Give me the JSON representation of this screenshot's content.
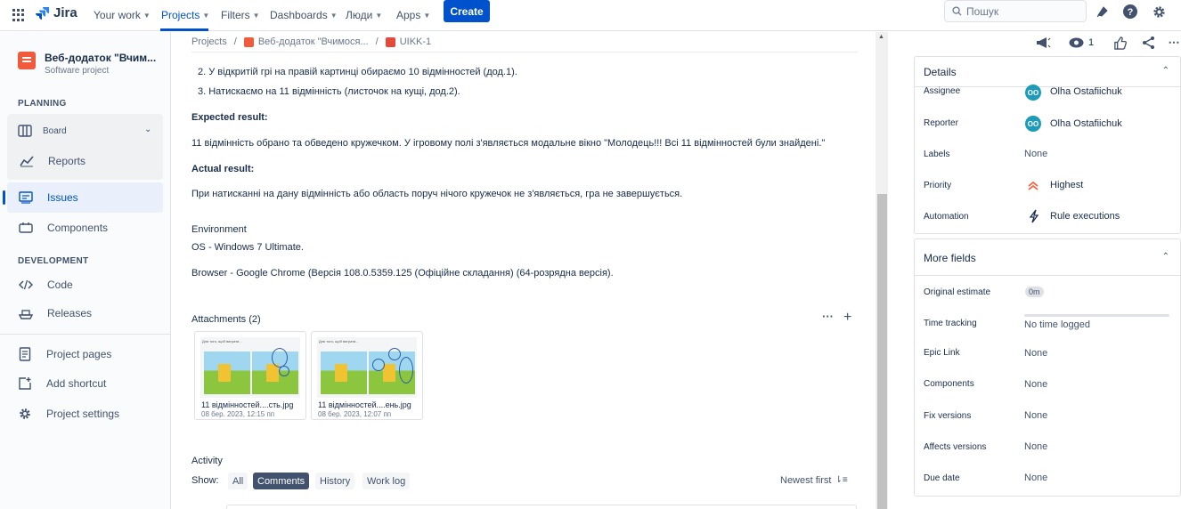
{
  "topnav": {
    "logo": "Jira",
    "items": [
      {
        "label": "Your work"
      },
      {
        "label": "Projects"
      },
      {
        "label": "Filters"
      },
      {
        "label": "Dashboards"
      },
      {
        "label": "Люди"
      },
      {
        "label": "Apps"
      }
    ],
    "create_label": "Create",
    "search_placeholder": "Пошук"
  },
  "sidebar": {
    "project_name": "Веб-додаток \"Вчим...",
    "project_type": "Software project",
    "planning_title": "PLANNING",
    "development_title": "DEVELOPMENT",
    "items": [
      {
        "label": "Board"
      },
      {
        "label": "Reports"
      },
      {
        "label": "Issues"
      },
      {
        "label": "Components"
      },
      {
        "label": "Code"
      },
      {
        "label": "Releases"
      },
      {
        "label": "Project pages"
      },
      {
        "label": "Add shortcut"
      },
      {
        "label": "Project settings"
      }
    ]
  },
  "breadcrumb": {
    "projects": "Projects",
    "project": "Веб-додаток \"Вчимося...",
    "issue": "UIKK-1"
  },
  "issue": {
    "steps": [
      "2. У відкритій грі на правій картинці обираємо 10 відмінностей (дод.1).",
      "3. Натискаємо на 11 відмінність (листочок на кущі, дод.2)."
    ],
    "expected_title": "Expected result:",
    "expected_text": "11 відмінність обрано та обведено кружечком.  У ігровому полі з'являється модальне вікно \"Молодець!!! Всі 11 відмінностей були знайдені.\"",
    "actual_title": "Actual result:",
    "actual_text": "При натисканні на дану відмінність або область поруч нічого кружечок не з'являється, гра не завершується.",
    "environment_title": "Environment",
    "os": "OS - Windows 7 Ultimate.",
    "browser": "Browser - Google Chrome (Версія 108.0.5359.125 (Офіційне складання) (64-розрядна версія)."
  },
  "attachments": {
    "title": "Attachments (2)",
    "files": [
      {
        "name": "11 відмінностей....сть.jpg",
        "date": "08 бер. 2023, 12:15 пп"
      },
      {
        "name": "11 відмінностей....ень.jpg",
        "date": "08 бер. 2023, 12:07 пп"
      }
    ]
  },
  "activity": {
    "title": "Activity",
    "show_label": "Show:",
    "filters": [
      "All",
      "Comments",
      "History",
      "Work log"
    ],
    "selected": "Comments",
    "sort_label": "Newest first"
  },
  "actions": {
    "watchers": "1"
  },
  "details": {
    "title": "Details",
    "fields": [
      {
        "label": "Assignee",
        "value": "Olha Ostafiichuk",
        "initials": "OO"
      },
      {
        "label": "Reporter",
        "value": "Olha Ostafiichuk",
        "initials": "OO"
      },
      {
        "label": "Labels",
        "value": "None"
      },
      {
        "label": "Priority",
        "value": "Highest"
      },
      {
        "label": "Automation",
        "value": "Rule executions"
      }
    ]
  },
  "more_fields": {
    "title": "More fields",
    "fields": [
      {
        "label": "Original estimate",
        "value": "0m"
      },
      {
        "label": "Time tracking",
        "value": "No time logged"
      },
      {
        "label": "Epic Link",
        "value": "None"
      },
      {
        "label": "Components",
        "value": "None"
      },
      {
        "label": "Fix versions",
        "value": "None"
      },
      {
        "label": "Affects versions",
        "value": "None"
      },
      {
        "label": "Due date",
        "value": "None"
      }
    ]
  },
  "colors": {
    "brand": "#0052cc",
    "priority_highest": "#ff5630",
    "avatar": "#1d9bb8"
  }
}
